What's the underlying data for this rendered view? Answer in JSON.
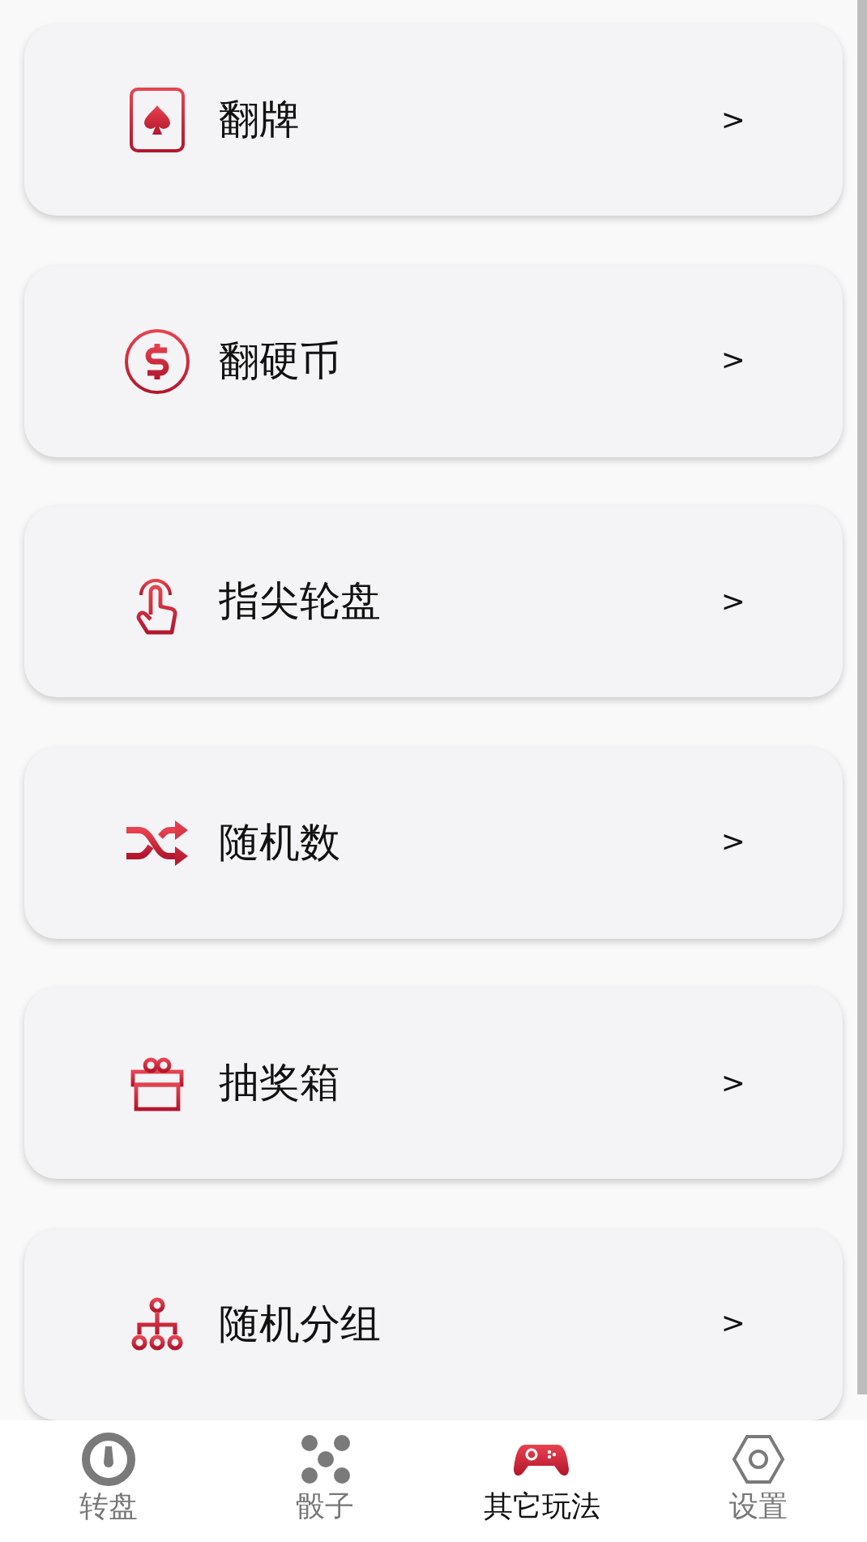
{
  "menu": [
    {
      "label": "翻牌",
      "chevron": ">"
    },
    {
      "label": "翻硬币",
      "chevron": ">"
    },
    {
      "label": "指尖轮盘",
      "chevron": ">"
    },
    {
      "label": "随机数",
      "chevron": ">"
    },
    {
      "label": "抽奖箱",
      "chevron": ">"
    },
    {
      "label": "随机分组",
      "chevron": ">"
    }
  ],
  "bottom_nav": [
    {
      "label": "转盘",
      "selected": false
    },
    {
      "label": "骰子",
      "selected": false
    },
    {
      "label": "其它玩法",
      "selected": true
    },
    {
      "label": "设置",
      "selected": false
    }
  ]
}
